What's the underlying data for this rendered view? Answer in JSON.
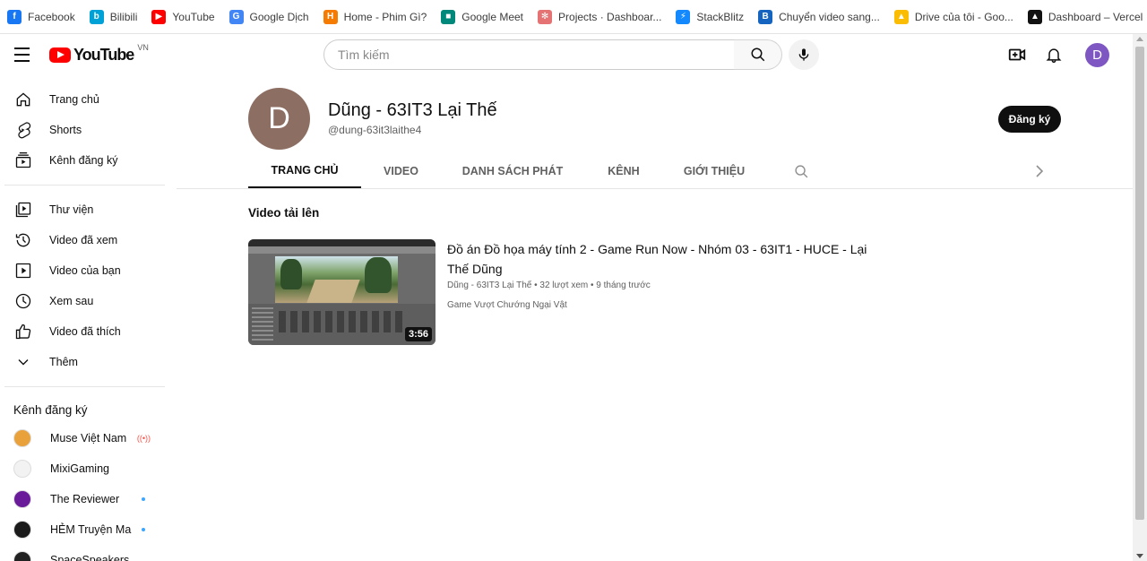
{
  "bookmarks": [
    {
      "label": "Facebook",
      "icon": "facebook-icon",
      "color": "#1877f2",
      "glyph": "f"
    },
    {
      "label": "Bilibili",
      "icon": "bilibili-icon",
      "color": "#00a1d6",
      "glyph": "b"
    },
    {
      "label": "YouTube",
      "icon": "youtube-icon",
      "color": "#ff0000",
      "glyph": "▶"
    },
    {
      "label": "Google Dịch",
      "icon": "google-translate-icon",
      "color": "#4285f4",
      "glyph": "G"
    },
    {
      "label": "Home - Phim Gì?",
      "icon": "phimgi-icon",
      "color": "#f57c00",
      "glyph": "H"
    },
    {
      "label": "Google Meet",
      "icon": "google-meet-icon",
      "color": "#00897b",
      "glyph": "■"
    },
    {
      "label": "Projects · Dashboar...",
      "icon": "projects-icon",
      "color": "#e57373",
      "glyph": "✻"
    },
    {
      "label": "StackBlitz",
      "icon": "stackblitz-icon",
      "color": "#1389fd",
      "glyph": "⚡"
    },
    {
      "label": "Chuyển video sang...",
      "icon": "convert-icon",
      "color": "#1565c0",
      "glyph": "B"
    },
    {
      "label": "Drive của tôi - Goo...",
      "icon": "google-drive-icon",
      "color": "#fbbc04",
      "glyph": "▲"
    },
    {
      "label": "Dashboard – Vercel",
      "icon": "vercel-icon",
      "color": "#111111",
      "glyph": "▲"
    }
  ],
  "header": {
    "logo_text": "YouTube",
    "country": "VN",
    "search_placeholder": "Tìm kiếm",
    "avatar_letter": "D"
  },
  "sidebar": {
    "main": [
      {
        "label": "Trang chủ",
        "icon": "home-icon"
      },
      {
        "label": "Shorts",
        "icon": "shorts-icon"
      },
      {
        "label": "Kênh đăng ký",
        "icon": "subscriptions-icon"
      }
    ],
    "library": [
      {
        "label": "Thư viện",
        "icon": "library-icon"
      },
      {
        "label": "Video đã xem",
        "icon": "history-icon"
      },
      {
        "label": "Video của bạn",
        "icon": "your-videos-icon"
      },
      {
        "label": "Xem sau",
        "icon": "watch-later-icon"
      },
      {
        "label": "Video đã thích",
        "icon": "liked-icon"
      },
      {
        "label": "Thêm",
        "icon": "chevron-down-icon"
      }
    ],
    "subscriptions_heading": "Kênh đăng ký",
    "channels": [
      {
        "name": "Muse Việt Nam",
        "status": "live",
        "color": "#e9a23b"
      },
      {
        "name": "MixiGaming",
        "status": "none",
        "color": "#f2f2f2"
      },
      {
        "name": "The Reviewer",
        "status": "new",
        "color": "#6a1b9a"
      },
      {
        "name": "HẺM Truyện Ma",
        "status": "new",
        "color": "#1b1b1b"
      },
      {
        "name": "SpaceSpeakers",
        "status": "none",
        "color": "#222222"
      }
    ]
  },
  "channel": {
    "avatar_letter": "D",
    "name": "Dũng - 63IT3 Lại Thế",
    "handle": "@dung-63it3laithe4",
    "subscribe_label": "Đăng ký"
  },
  "tabs": [
    {
      "label": "TRANG CHỦ",
      "active": true
    },
    {
      "label": "VIDEO",
      "active": false
    },
    {
      "label": "DANH SÁCH PHÁT",
      "active": false
    },
    {
      "label": "KÊNH",
      "active": false
    },
    {
      "label": "GIỚI THIỆU",
      "active": false
    }
  ],
  "uploads": {
    "section_title": "Video tải lên",
    "video": {
      "title": "Đồ án Đồ họa máy tính 2 - Game Run Now - Nhóm 03 - 63IT1 - HUCE - Lại Thế Dũng",
      "channel": "Dũng - 63IT3 Lại Thế",
      "views": "32 lượt xem",
      "age": "9 tháng trước",
      "description": "Game Vượt Chướng Ngại Vật",
      "duration": "3:56"
    }
  }
}
